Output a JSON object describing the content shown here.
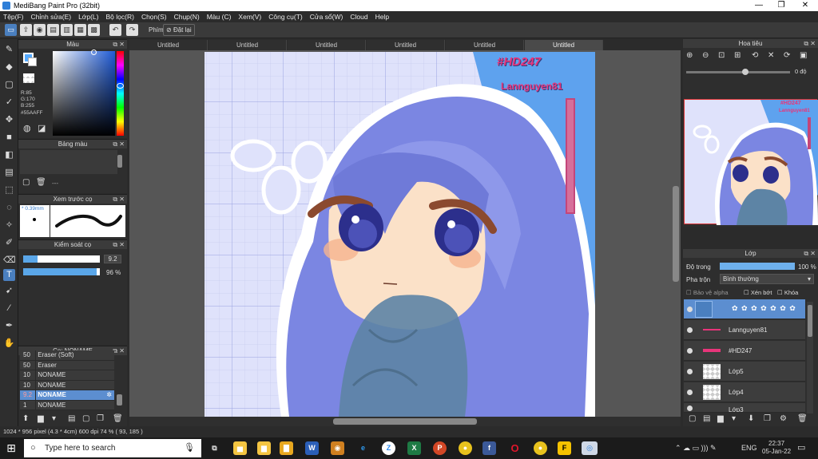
{
  "window": {
    "title": "MediBang Paint Pro (32bit)"
  },
  "menu": [
    "Tệp(F)",
    "Chỉnh sửa(E)",
    "Lớp(L)",
    "Bộ lọc(R)",
    "Chọn(S)",
    "Chụp(N)",
    "Màu (C)",
    "Xem(V)",
    "Công cụ(T)",
    "Cửa sổ(W)",
    "Cloud",
    "Help"
  ],
  "toolbar": {
    "shortcut_label": "Phím",
    "reset_label": "Đặt lại"
  },
  "tabs": [
    "Untitled",
    "Untitled",
    "Untitled",
    "Untitled",
    "Untitled",
    "Untitled"
  ],
  "panels": {
    "color": {
      "title": "Màu",
      "r": "R:85",
      "g": "G:170",
      "b": "B:255",
      "hex": "#55AAFF",
      "main_color": "#55AAFF"
    },
    "palette": {
      "title": "Bảng màu",
      "dash": "---"
    },
    "brush_preview": {
      "title": "Xem trước cọ",
      "size": "* 0.39mm"
    },
    "brush_control": {
      "title": "Kiểm soát cọ",
      "size_value": "9.2",
      "opacity_value": "96 %",
      "size_fraction": 0.74,
      "opacity_fraction": 0.96
    },
    "brush_list": {
      "title": "Cọ: NONAME",
      "rows": [
        {
          "size": "50",
          "name": "Eraser (Soft)"
        },
        {
          "size": "50",
          "name": "Eraser"
        },
        {
          "size": "10",
          "name": "NONAME"
        },
        {
          "size": "10",
          "name": "NONAME"
        },
        {
          "size": "9.2",
          "name": "NONAME"
        },
        {
          "size": "1",
          "name": "NONAME"
        }
      ]
    }
  },
  "navigator": {
    "title": "Hoa tiêu",
    "angle": "0 độ"
  },
  "layers": {
    "title": "Lớp",
    "opacity_label": "Độ trong",
    "opacity_value": "100 %",
    "blend_label": "Pha trộn",
    "blend_value": "Bình thường",
    "protect_alpha": "Bảo vệ alpha",
    "clipping": "Xén bớt",
    "lock": "Khóa",
    "items": [
      "Lannguyen81",
      "#HD247",
      "Lớp5",
      "Lớp4",
      "Lớp3"
    ]
  },
  "canvas": {
    "text_tag": "#HD247",
    "text_name": "Lannguyen81"
  },
  "status": {
    "text": "1024 * 956 pixel   (4.3 * 4cm)  600 dpi   74 %   ( 93, 185 )"
  },
  "taskbar": {
    "search_placeholder": "Type here to search",
    "time": "22:37",
    "date": "05-Jan-22",
    "lang": "ENG"
  }
}
